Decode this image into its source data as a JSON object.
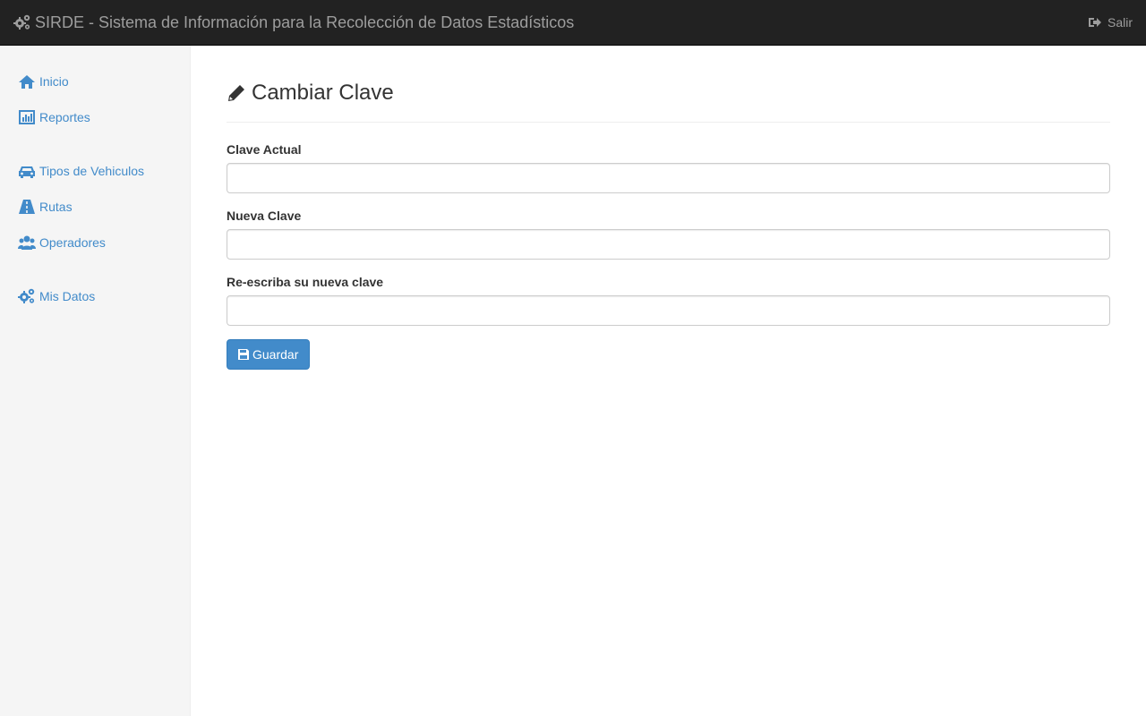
{
  "header": {
    "brand": "SIRDE - Sistema de Información para la Recolección de Datos Estadísticos",
    "logout_label": "Salir"
  },
  "sidebar": {
    "items": [
      {
        "label": "Inicio",
        "icon": "home-icon"
      },
      {
        "label": "Reportes",
        "icon": "bar-chart-icon"
      },
      {
        "label": "Tipos de Vehiculos",
        "icon": "car-icon"
      },
      {
        "label": "Rutas",
        "icon": "road-icon"
      },
      {
        "label": "Operadores",
        "icon": "users-icon"
      },
      {
        "label": "Mis Datos",
        "icon": "gears-icon"
      }
    ]
  },
  "main": {
    "title": "Cambiar Clave",
    "fields": [
      {
        "label": "Clave Actual",
        "value": ""
      },
      {
        "label": "Nueva Clave",
        "value": ""
      },
      {
        "label": "Re-escriba su nueva clave",
        "value": ""
      }
    ],
    "save_label": "Guardar"
  },
  "colors": {
    "navbar": "#222222",
    "link": "#428bca",
    "button": "#428bca",
    "sidebar": "#f5f5f5"
  }
}
